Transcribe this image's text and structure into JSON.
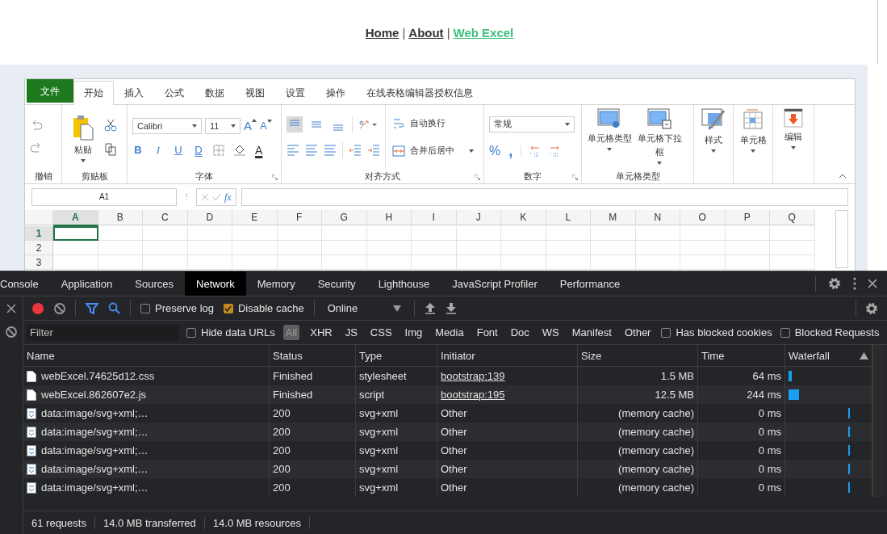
{
  "nav": {
    "items": [
      {
        "kind": "link",
        "label": "Home",
        "selected": false
      },
      {
        "kind": "separator",
        "label": "|"
      },
      {
        "kind": "link",
        "label": "About",
        "selected": false
      },
      {
        "kind": "separator",
        "label": "|"
      },
      {
        "kind": "link",
        "label": "Web Excel",
        "selected": true
      }
    ]
  },
  "ribbon": {
    "file_tab": "文件",
    "tabs": [
      {
        "label": "开始",
        "selected": true
      },
      {
        "label": "插入",
        "selected": false
      },
      {
        "label": "公式",
        "selected": false
      },
      {
        "label": "数据",
        "selected": false
      },
      {
        "label": "视图",
        "selected": false
      },
      {
        "label": "设置",
        "selected": false
      },
      {
        "label": "操作",
        "selected": false
      },
      {
        "label": "在线表格编辑器授权信息",
        "selected": false
      }
    ],
    "undo": {
      "label": "撤销"
    },
    "clipboard": {
      "label": "剪贴板",
      "paste": "粘贴"
    },
    "font": {
      "label": "字体",
      "family": "Calibri",
      "size": "11",
      "grow": "A",
      "shrink": "A",
      "styles": [
        "B",
        "I",
        "U",
        "D"
      ],
      "font_color_button": "A"
    },
    "alignment": {
      "label": "对齐方式",
      "wrap": "自动换行",
      "merge": "合并后居中",
      "vertical": [
        {
          "selected": true
        },
        {
          "selected": false
        },
        {
          "selected": false
        }
      ]
    },
    "number": {
      "label": "数字",
      "format": "常规",
      "percent": "%",
      "comma": ","
    },
    "cell_type": {
      "label": "单元格类型",
      "buttons": [
        "单元格类型",
        "单元格下拉框"
      ]
    },
    "big_buttons": [
      {
        "kind": "style",
        "label": "样式"
      },
      {
        "kind": "cells",
        "label": "单元格"
      },
      {
        "kind": "edit",
        "label": "编辑"
      }
    ]
  },
  "formula_bar": {
    "name_box": "A1",
    "more": "⋮",
    "fx": "fx"
  },
  "grid": {
    "columns": [
      {
        "label": "A",
        "selected": true
      },
      {
        "label": "B",
        "selected": false
      },
      {
        "label": "C",
        "selected": false
      },
      {
        "label": "D",
        "selected": false
      },
      {
        "label": "E",
        "selected": false
      },
      {
        "label": "F",
        "selected": false
      },
      {
        "label": "G",
        "selected": false
      },
      {
        "label": "H",
        "selected": false
      },
      {
        "label": "I",
        "selected": false
      },
      {
        "label": "J",
        "selected": false
      },
      {
        "label": "K",
        "selected": false
      },
      {
        "label": "L",
        "selected": false
      },
      {
        "label": "M",
        "selected": false
      },
      {
        "label": "N",
        "selected": false
      },
      {
        "label": "O",
        "selected": false
      },
      {
        "label": "P",
        "selected": false
      },
      {
        "label": "Q",
        "selected": false
      }
    ],
    "rows": [
      {
        "label": "1",
        "selected": true
      },
      {
        "label": "2",
        "selected": false
      },
      {
        "label": "3",
        "selected": false
      }
    ]
  },
  "devtools": {
    "tabs": [
      {
        "label": "Console",
        "selected": false
      },
      {
        "label": "Application",
        "selected": false
      },
      {
        "label": "Sources",
        "selected": false
      },
      {
        "label": "Network",
        "selected": true
      },
      {
        "label": "Memory",
        "selected": false
      },
      {
        "label": "Security",
        "selected": false
      },
      {
        "label": "Lighthouse",
        "selected": false
      },
      {
        "label": "JavaScript Profiler",
        "selected": false
      },
      {
        "label": "Performance",
        "selected": false
      }
    ],
    "toolbar": {
      "preserve_log": {
        "label": "Preserve log",
        "checked": false
      },
      "disable_cache": {
        "label": "Disable cache",
        "checked": true
      },
      "throttling": "Online"
    },
    "filter": {
      "placeholder": "Filter",
      "hide_data_urls": {
        "label": "Hide data URLs",
        "checked": false
      },
      "types": [
        {
          "label": "All",
          "selected": true
        },
        {
          "label": "XHR",
          "selected": false
        },
        {
          "label": "JS",
          "selected": false
        },
        {
          "label": "CSS",
          "selected": false
        },
        {
          "label": "Img",
          "selected": false
        },
        {
          "label": "Media",
          "selected": false
        },
        {
          "label": "Font",
          "selected": false
        },
        {
          "label": "Doc",
          "selected": false
        },
        {
          "label": "WS",
          "selected": false
        },
        {
          "label": "Manifest",
          "selected": false
        },
        {
          "label": "Other",
          "selected": false
        }
      ],
      "blocked_cookies": {
        "label": "Has blocked cookies",
        "checked": false
      },
      "blocked_requests": {
        "label": "Blocked Requests",
        "checked": false
      }
    },
    "table": {
      "columns": [
        "Name",
        "Status",
        "Type",
        "Initiator",
        "Size",
        "Time",
        "Waterfall"
      ],
      "rows": [
        {
          "kind": "stylesheet",
          "name": "webExcel.74625d12.css",
          "status": "Finished",
          "type": "stylesheet",
          "initiator": "bootstrap:139",
          "size": "1.5 MB",
          "time": "64 ms"
        },
        {
          "kind": "script",
          "name": "webExcel.862607e2.js",
          "status": "Finished",
          "type": "script",
          "initiator": "bootstrap:195",
          "size": "12.5 MB",
          "time": "244 ms"
        },
        {
          "kind": "cached",
          "name": "data:image/svg+xml;…",
          "status": "200",
          "type": "svg+xml",
          "initiator": "Other",
          "size": "(memory cache)",
          "time": "0 ms"
        },
        {
          "kind": "cached",
          "name": "data:image/svg+xml;…",
          "status": "200",
          "type": "svg+xml",
          "initiator": "Other",
          "size": "(memory cache)",
          "time": "0 ms"
        },
        {
          "kind": "cached",
          "name": "data:image/svg+xml;…",
          "status": "200",
          "type": "svg+xml",
          "initiator": "Other",
          "size": "(memory cache)",
          "time": "0 ms"
        },
        {
          "kind": "cached",
          "name": "data:image/svg+xml;…",
          "status": "200",
          "type": "svg+xml",
          "initiator": "Other",
          "size": "(memory cache)",
          "time": "0 ms"
        },
        {
          "kind": "cached",
          "name": "data:image/svg+xml;…",
          "status": "200",
          "type": "svg+xml",
          "initiator": "Other",
          "size": "(memory cache)",
          "time": "0 ms"
        }
      ]
    },
    "status_bar": [
      "61 requests",
      "14.0 MB transferred",
      "14.0 MB resources"
    ]
  }
}
